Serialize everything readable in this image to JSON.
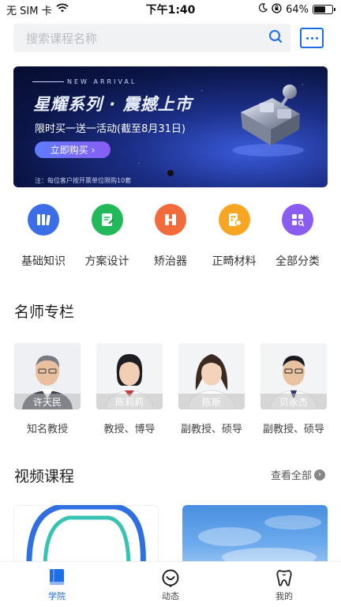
{
  "status": {
    "carrier": "无 SIM 卡",
    "time": "下午1:40",
    "battery": "64%",
    "battery_level": 0.64
  },
  "search": {
    "placeholder": "搜索课程名称"
  },
  "banner": {
    "subtitle": "NEW ARRIVAL",
    "title": "星耀系列 · 震撼上市",
    "promo": "限时买一送一活动(截至8月31日)",
    "button": "立即购买",
    "note": "注：每位客户按开票单位限购10套"
  },
  "categories": [
    {
      "label": "基础知识",
      "icon": "books-icon",
      "color": "#3b6ee6"
    },
    {
      "label": "方案设计",
      "icon": "document-edit-icon",
      "color": "#23b85a"
    },
    {
      "label": "矫治器",
      "icon": "bracket-icon",
      "color": "#f26b3a"
    },
    {
      "label": "正畸材料",
      "icon": "materials-icon",
      "color": "#f6a623"
    },
    {
      "label": "全部分类",
      "icon": "grid-icon",
      "color": "#8a5cf0"
    }
  ],
  "teachers_section": {
    "title": "名师专栏"
  },
  "teachers": [
    {
      "name": "许天民",
      "title": "知名教授"
    },
    {
      "name": "陈莉莉",
      "title": "教授、博导"
    },
    {
      "name": "陈斯",
      "title": "副教授、硕导"
    },
    {
      "name": "贝永杰",
      "title": "副教授、硕导"
    }
  ],
  "videos_section": {
    "title": "视频课程",
    "see_all": "查看全部"
  },
  "tabs": [
    {
      "label": "学院",
      "icon": "book-icon",
      "active": true
    },
    {
      "label": "动态",
      "icon": "smile-icon",
      "active": false
    },
    {
      "label": "我的",
      "icon": "tooth-icon",
      "active": false
    }
  ],
  "colors": {
    "accent": "#1e6ee8"
  }
}
